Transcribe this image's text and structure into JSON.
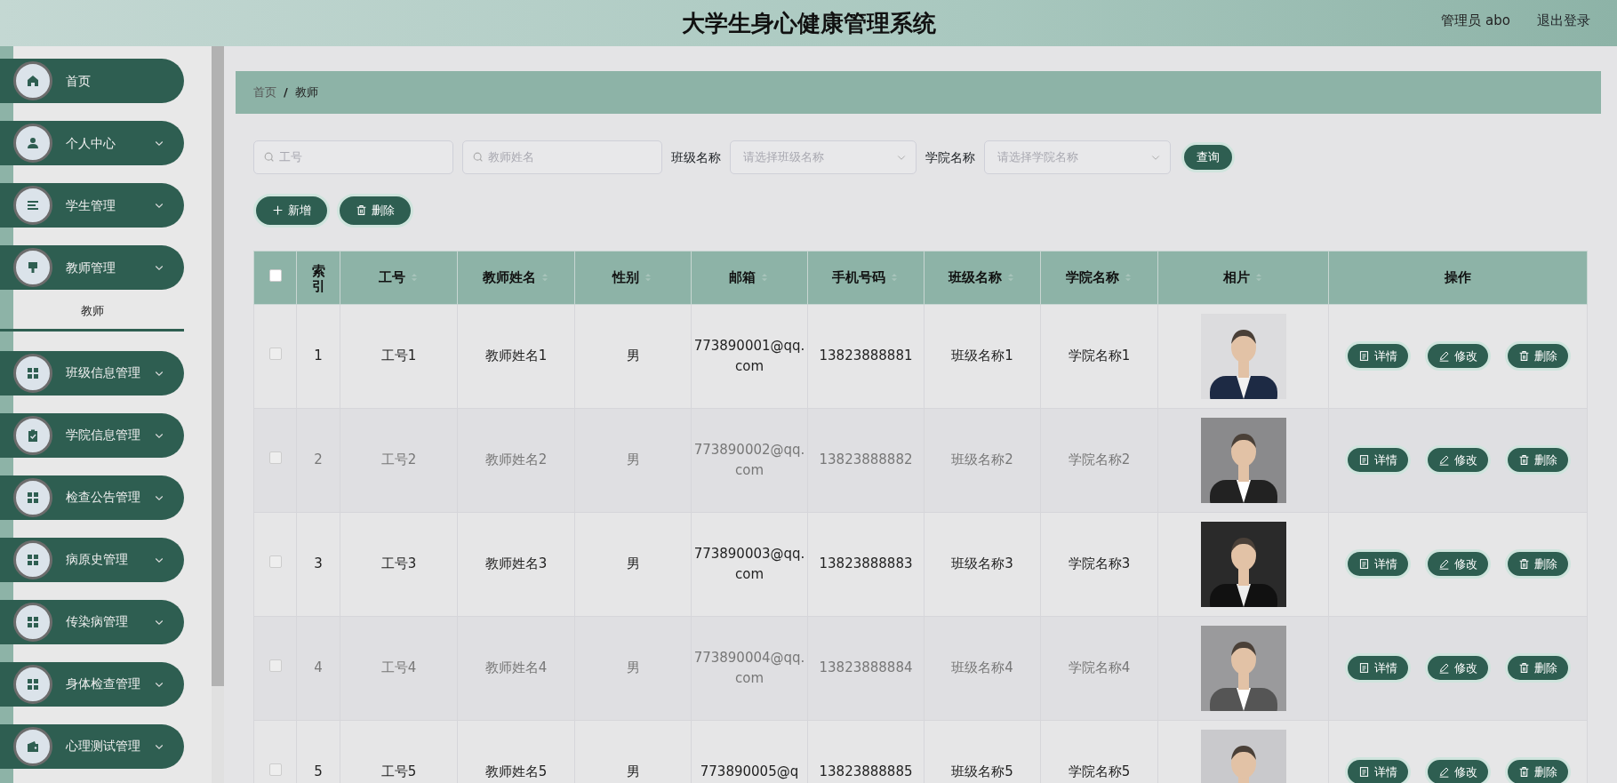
{
  "header": {
    "title": "大学生身心健康管理系统",
    "user": "管理员 abo",
    "logout": "退出登录"
  },
  "sidebar": {
    "items": [
      {
        "label": "首页",
        "kind": "home",
        "expandable": false
      },
      {
        "label": "个人中心",
        "kind": "user",
        "expandable": true
      },
      {
        "label": "学生管理",
        "kind": "list",
        "expandable": true
      },
      {
        "label": "教师管理",
        "kind": "brush",
        "expandable": true,
        "children": [
          {
            "label": "教师",
            "selected": true
          }
        ]
      },
      {
        "label": "班级信息管理",
        "kind": "grid",
        "expandable": true
      },
      {
        "label": "学院信息管理",
        "kind": "clipboard",
        "expandable": true
      },
      {
        "label": "检查公告管理",
        "kind": "grid",
        "expandable": true
      },
      {
        "label": "病原史管理",
        "kind": "grid",
        "expandable": true
      },
      {
        "label": "传染病管理",
        "kind": "grid",
        "expandable": true
      },
      {
        "label": "身体检查管理",
        "kind": "grid",
        "expandable": true
      },
      {
        "label": "心理测试管理",
        "kind": "wallet",
        "expandable": true
      }
    ]
  },
  "breadcrumb": {
    "items": [
      "首页",
      "教师"
    ],
    "separator": "/"
  },
  "filters": [
    {
      "kind": "text",
      "placeholder": "工号"
    },
    {
      "kind": "text",
      "placeholder": "教师姓名"
    },
    {
      "kind": "select",
      "label": "班级名称",
      "placeholder": "请选择班级名称"
    },
    {
      "kind": "select",
      "label": "学院名称",
      "placeholder": "请选择学院名称"
    }
  ],
  "search_button": "查询",
  "actions": [
    {
      "kind": "add",
      "label": "新增"
    },
    {
      "kind": "delete",
      "label": "删除"
    }
  ],
  "table": {
    "select_all": false,
    "columns": [
      {
        "label": "索引",
        "sortable": false
      },
      {
        "label": "工号",
        "sortable": true
      },
      {
        "label": "教师姓名",
        "sortable": true
      },
      {
        "label": "性别",
        "sortable": true
      },
      {
        "label": "邮箱",
        "sortable": true
      },
      {
        "label": "手机号码",
        "sortable": true
      },
      {
        "label": "班级名称",
        "sortable": true
      },
      {
        "label": "学院名称",
        "sortable": true
      },
      {
        "label": "相片",
        "sortable": true
      },
      {
        "label": "操作",
        "sortable": false
      }
    ],
    "rows": [
      {
        "checked": false,
        "cells": [
          "1",
          "工号1",
          "教师姓名1",
          "男",
          "773890001@qq.com",
          "13823888881",
          "班级名称1",
          "学院名称1"
        ],
        "photo": {
          "kind": "picture"
        },
        "buttons": [
          {
            "kind": "detail",
            "label": "详情"
          },
          {
            "kind": "edit",
            "label": "修改"
          },
          {
            "kind": "delete",
            "label": "删除"
          }
        ]
      },
      {
        "checked": false,
        "cells": [
          "2",
          "工号2",
          "教师姓名2",
          "男",
          "773890002@qq.com",
          "13823888882",
          "班级名称2",
          "学院名称2"
        ],
        "photo": {
          "kind": "picture"
        },
        "buttons": [
          {
            "kind": "detail",
            "label": "详情"
          },
          {
            "kind": "edit",
            "label": "修改"
          },
          {
            "kind": "delete",
            "label": "删除"
          }
        ]
      },
      {
        "checked": false,
        "cells": [
          "3",
          "工号3",
          "教师姓名3",
          "男",
          "773890003@qq.com",
          "13823888883",
          "班级名称3",
          "学院名称3"
        ],
        "photo": {
          "kind": "picture"
        },
        "buttons": [
          {
            "kind": "detail",
            "label": "详情"
          },
          {
            "kind": "edit",
            "label": "修改"
          },
          {
            "kind": "delete",
            "label": "删除"
          }
        ]
      },
      {
        "checked": false,
        "cells": [
          "4",
          "工号4",
          "教师姓名4",
          "男",
          "773890004@qq.com",
          "13823888884",
          "班级名称4",
          "学院名称4"
        ],
        "photo": {
          "kind": "picture"
        },
        "buttons": [
          {
            "kind": "detail",
            "label": "详情"
          },
          {
            "kind": "edit",
            "label": "修改"
          },
          {
            "kind": "delete",
            "label": "删除"
          }
        ]
      },
      {
        "checked": false,
        "cells": [
          "5",
          "工号5",
          "教师姓名5",
          "男",
          "773890005@q",
          "13823888885",
          "班级名称5",
          "学院名称5"
        ],
        "photo": {
          "kind": "picture"
        },
        "buttons": [
          {
            "kind": "detail",
            "label": "详情"
          },
          {
            "kind": "edit",
            "label": "修改"
          },
          {
            "kind": "delete",
            "label": "删除"
          }
        ]
      }
    ]
  }
}
